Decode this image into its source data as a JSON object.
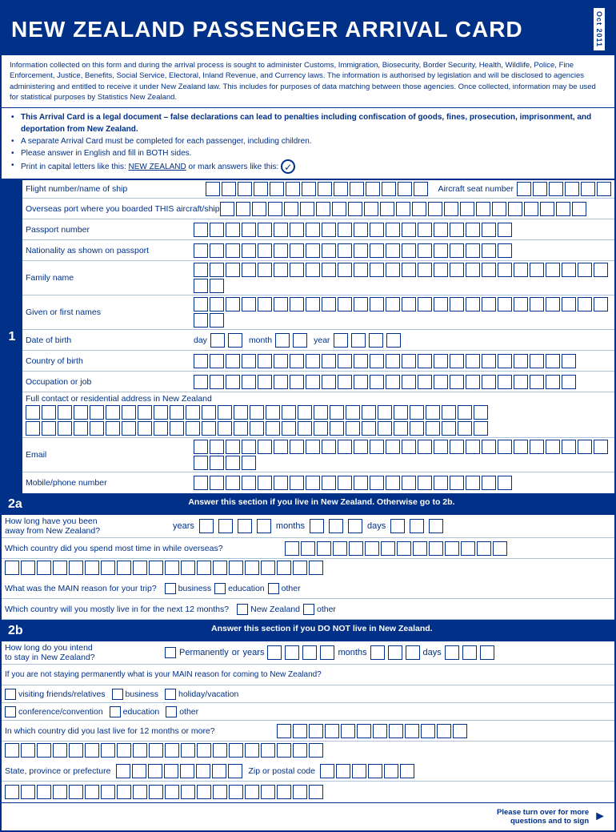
{
  "header": {
    "title": "NEW ZEALAND PASSENGER ARRIVAL CARD",
    "year": "Oct 2011"
  },
  "info_text": "Information collected on this form and during the arrival process is sought to administer Customs, Immigration, Biosecurity, Border Security, Health, Wildlife, Police, Fine Enforcement, Justice, Benefits, Social Service, Electoral, Inland Revenue, and Currency laws. The information is authorised by legislation and will be disclosed to agencies administering and entitled to receive it under New Zealand law. This includes for purposes of data matching between those agencies. Once collected, information may be used for statistical purposes by Statistics New Zealand.",
  "bullets": [
    {
      "text": "This Arrival Card is a legal document – false declarations can lead to penalties including confiscation of goods, fines, prosecution, imprisonment, and deportation from New Zealand.",
      "bold": true
    },
    {
      "text": "A separate Arrival Card must be completed for each passenger, including children.",
      "bold": false
    },
    {
      "text": "Please answer in English and fill in BOTH sides.",
      "bold": false
    },
    {
      "text_prefix": "Print in capital letters like this: ",
      "underline": "NEW ZEALAND",
      "text_suffix": " or mark answers like this:",
      "has_checkmark": true,
      "bold": false
    }
  ],
  "section1": {
    "number": "1",
    "rows": [
      {
        "label": "Flight number/name of ship",
        "boxes": 18,
        "extra_label": "Aircraft seat number",
        "extra_boxes": 8
      },
      {
        "label": "Overseas port where you boarded THIS aircraft/ship",
        "boxes": 32
      },
      {
        "label": "Passport number",
        "boxes": 22
      },
      {
        "label": "Nationality as shown on passport",
        "boxes": 22
      },
      {
        "label": "Family name",
        "boxes": 30
      },
      {
        "label": "Given or first names",
        "boxes": 30
      },
      {
        "label": "Date of birth",
        "dob": true,
        "day_label": "day",
        "day_boxes": 2,
        "month_label": "month",
        "month_boxes": 2,
        "year_label": "year",
        "year_boxes": 4
      },
      {
        "label": "Country of birth",
        "boxes": 26
      },
      {
        "label": "Occupation or job",
        "boxes": 26
      },
      {
        "label": "Full contact or residential\naddress in New Zealand",
        "boxes_row1": 26,
        "boxes_row2": 26,
        "multirow": true
      },
      {
        "label": "Email",
        "boxes": 30
      },
      {
        "label": "Mobile/phone number",
        "boxes": 20
      }
    ]
  },
  "section2a": {
    "number": "2a",
    "header": "Answer this section if you live in New Zealand. Otherwise go to 2b.",
    "rows": [
      {
        "type": "ymd",
        "label": "How long have you been\naway from New Zealand?",
        "years_label": "years",
        "years_boxes": 4,
        "months_label": "months",
        "months_boxes": 3,
        "days_label": "days",
        "days_boxes": 3
      },
      {
        "type": "text",
        "label": "Which country did you spend most time in while overseas?",
        "boxes": 18
      },
      {
        "type": "reason",
        "label": "What was the MAIN reason for your trip?",
        "options": [
          "business",
          "education",
          "other"
        ]
      },
      {
        "type": "next12",
        "label": "Which country will you mostly live in for the next 12 months?",
        "option1": "New Zealand",
        "option2": "other"
      }
    ]
  },
  "section2b": {
    "number": "2b",
    "header": "Answer this section if you DO NOT live in New Zealand.",
    "rows": [
      {
        "type": "intend",
        "label": "How long do you intend\nto stay in New Zealand?",
        "perm_label": "Permanently",
        "or_label": "or",
        "years_label": "years",
        "years_boxes": 4,
        "months_label": "months",
        "months_boxes": 3,
        "days_label": "days",
        "days_boxes": 3
      },
      {
        "type": "main-reason-long",
        "label": "If you are not staying permanently what is your MAIN reason for coming to New Zealand?",
        "options": [
          [
            "visiting friends/relatives",
            "business",
            "holiday/vacation"
          ],
          [
            "conference/convention",
            "education",
            "other"
          ]
        ]
      },
      {
        "type": "last-country",
        "label": "In which country did you last live for 12 months or more?",
        "boxes": 20
      },
      {
        "type": "state-zip",
        "state_label": "State, province or prefecture",
        "state_boxes": 12,
        "zip_label": "Zip or postal code",
        "zip_boxes": 8
      },
      {
        "type": "final-boxes",
        "boxes": 20
      }
    ]
  },
  "footer": {
    "note": "Please turn over for more\nquestions and to sign"
  }
}
